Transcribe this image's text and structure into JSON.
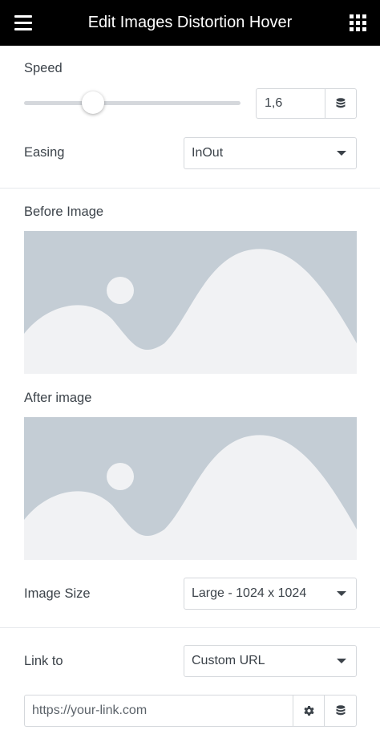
{
  "header": {
    "title": "Edit Images Distortion Hover",
    "menu_icon": "hamburger-icon",
    "widgets_icon": "grid-icon"
  },
  "speed": {
    "label": "Speed",
    "value": "1,6",
    "slider_fraction": 0.32,
    "dynamic_icon": "database-icon"
  },
  "easing": {
    "label": "Easing",
    "selected": "InOut"
  },
  "before_image": {
    "label": "Before Image",
    "icon": "image-placeholder-icon"
  },
  "after_image": {
    "label": "After image",
    "icon": "image-placeholder-icon"
  },
  "image_size": {
    "label": "Image Size",
    "selected": "Large - 1024 x 1024"
  },
  "link": {
    "label": "Link to",
    "selected": "Custom URL",
    "placeholder": "https://your-link.com",
    "options_icon": "gear-icon",
    "dynamic_icon": "database-icon"
  },
  "colors": {
    "header_bg": "#000000",
    "placeholder_bg": "#c4cdd5",
    "placeholder_fg": "#f1f2f4",
    "border": "#d5d8dc"
  }
}
